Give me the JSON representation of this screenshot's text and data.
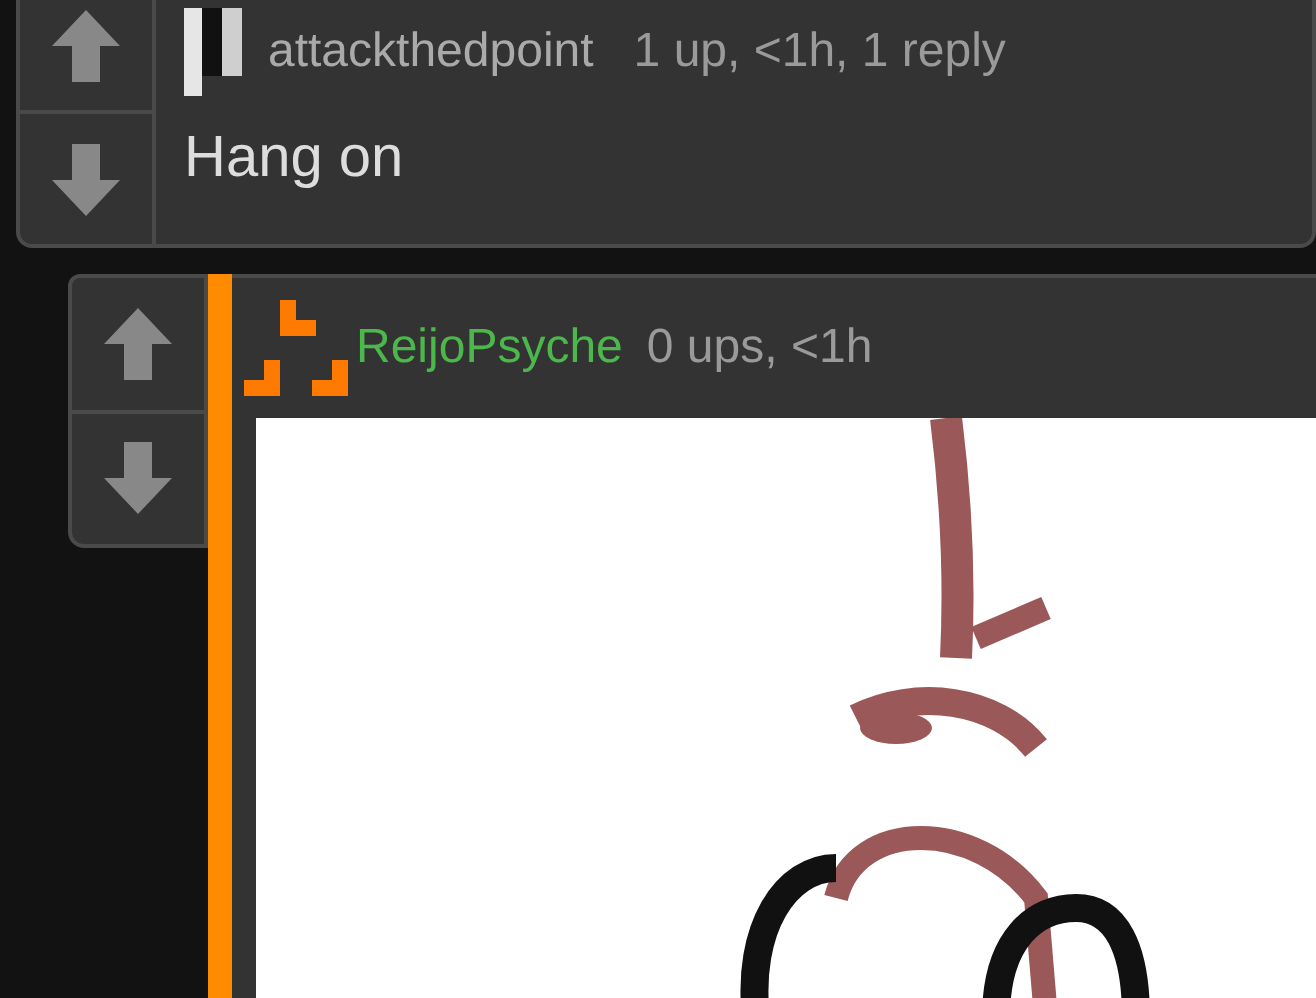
{
  "comments": [
    {
      "username": "attackthedpoint",
      "color": "#aaaaaa",
      "avatar": {
        "kind": "bars"
      },
      "meta": "1 up, <1h, 1 reply",
      "body": "Hang on",
      "children": [
        {
          "username": "ReijoPsyche",
          "color": "#4cb84c",
          "avatar": {
            "kind": "steps"
          },
          "meta": "0 ups, <1h"
        }
      ]
    }
  ]
}
